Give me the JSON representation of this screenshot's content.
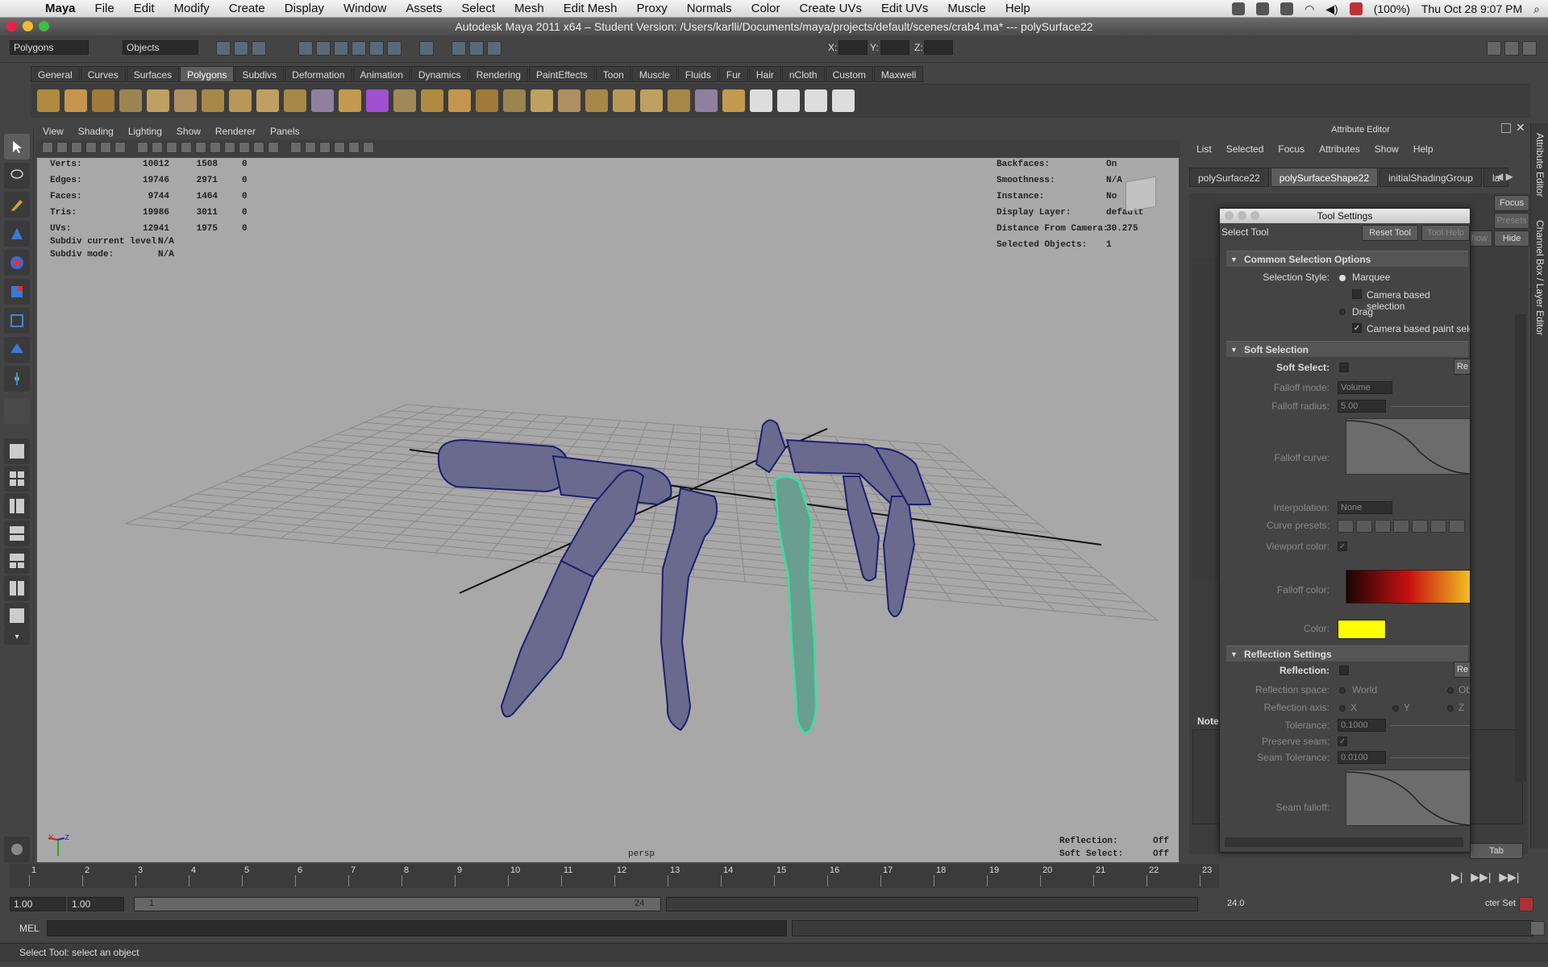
{
  "macmenu": {
    "app": "Maya",
    "items": [
      "File",
      "Edit",
      "Modify",
      "Create",
      "Display",
      "Window",
      "Assets",
      "Select",
      "Mesh",
      "Edit Mesh",
      "Proxy",
      "Normals",
      "Color",
      "Create UVs",
      "Edit UVs",
      "Muscle",
      "Help"
    ],
    "battery": "(100%)",
    "clock": "Thu Oct 28  9:07 PM"
  },
  "window": {
    "title": "Autodesk Maya 2011 x64 – Student Version: /Users/karlli/Documents/maya/projects/default/scenes/crab4.ma*   ---   polySurface22"
  },
  "statusline": {
    "menuset": "Polygons",
    "selection_mode": "Objects",
    "x_label": "X:",
    "y_label": "Y:",
    "z_label": "Z:"
  },
  "shelf_tabs": [
    "General",
    "Curves",
    "Surfaces",
    "Polygons",
    "Subdivs",
    "Deformation",
    "Animation",
    "Dynamics",
    "Rendering",
    "PaintEffects",
    "Toon",
    "Muscle",
    "Fluids",
    "Fur",
    "Hair",
    "nCloth",
    "Custom",
    "Maxwell"
  ],
  "shelf_active": "Polygons",
  "viewport": {
    "menus": [
      "View",
      "Shading",
      "Lighting",
      "Show",
      "Renderer",
      "Panels"
    ],
    "hud_left": [
      {
        "label": "Verts:",
        "a": "10012",
        "b": "1508",
        "c": "0"
      },
      {
        "label": "Edges:",
        "a": "19746",
        "b": "2971",
        "c": "0"
      },
      {
        "label": "Faces:",
        "a": "9744",
        "b": "1464",
        "c": "0"
      },
      {
        "label": "Tris:",
        "a": "19986",
        "b": "3011",
        "c": "0"
      },
      {
        "label": "UVs:",
        "a": "12941",
        "b": "1975",
        "c": "0"
      }
    ],
    "subdiv_level_label": "Subdiv current level:",
    "subdiv_level_value": "N/A",
    "subdiv_mode_label": "Subdiv mode:",
    "subdiv_mode_value": "N/A",
    "hud_right": [
      {
        "label": "Backfaces:",
        "value": "On"
      },
      {
        "label": "Smoothness:",
        "value": "N/A"
      },
      {
        "label": "Instance:",
        "value": "No"
      },
      {
        "label": "Display Layer:",
        "value": "default"
      },
      {
        "label": "Distance From Camera:",
        "value": "30.275"
      },
      {
        "label": "Selected Objects:",
        "value": "1"
      }
    ],
    "camera": "persp",
    "reflection_label": "Reflection:",
    "reflection_value": "Off",
    "softselect_label": "Soft Select:",
    "softselect_value": "Off",
    "axis_x": "x",
    "axis_z": "z"
  },
  "timeline": {
    "ticks": [
      "1",
      "2",
      "3",
      "4",
      "5",
      "6",
      "7",
      "8",
      "9",
      "10",
      "11",
      "12",
      "13",
      "14",
      "15",
      "16",
      "17",
      "18",
      "19",
      "20",
      "21",
      "22",
      "23"
    ],
    "start": "1.00",
    "start2": "1.00",
    "range_start": "1",
    "range_end": "24",
    "end": "24.0",
    "char_set": "cter Set"
  },
  "mel_label": "MEL",
  "help_line": "Select Tool: select an object",
  "attribute_editor": {
    "title": "Attribute Editor",
    "menus": [
      "List",
      "Selected",
      "Focus",
      "Attributes",
      "Show",
      "Help"
    ],
    "tabs": [
      "polySurface22",
      "polySurfaceShape22",
      "initialShadingGroup",
      "la"
    ],
    "active_tab": "polySurfaceShape22",
    "focus_button": "Focus",
    "presets_button": "Presets",
    "show_button": "how",
    "hide_button": "Hide",
    "notes_label": "Notes",
    "tab_button": "Tab",
    "side_attr": "Attribute Editor",
    "side_channel": "Channel Box / Layer Editor"
  },
  "tool_settings": {
    "title": "Tool Settings",
    "tool_name": "Select Tool",
    "reset_button": "Reset Tool",
    "help_button": "Tool Help",
    "sec_common": "Common Selection Options",
    "selection_style_label": "Selection Style:",
    "marquee": "Marquee",
    "camera_based_selection": "Camera based selection",
    "drag": "Drag",
    "camera_based_paint": "Camera based paint sele",
    "sec_soft": "Soft Selection",
    "soft_select_label": "Soft Select:",
    "reset_short": "Re",
    "falloff_mode_label": "Falloff mode:",
    "falloff_mode_value": "Volume",
    "falloff_radius_label": "Falloff radius:",
    "falloff_radius_value": "5.00",
    "falloff_curve_label": "Falloff curve:",
    "interpolation_label": "Interpolation:",
    "interpolation_value": "None",
    "curve_presets_label": "Curve presets:",
    "viewport_color_label": "Viewport color:",
    "falloff_color_label": "Falloff color:",
    "color_label": "Color:",
    "color_swatch": "#ffff00",
    "sec_reflection": "Reflection Settings",
    "reflection_label": "Reflection:",
    "reflection_space_label": "Reflection space:",
    "reflection_space_world": "World",
    "reflection_space_obj": "Ob",
    "reflection_axis_label": "Reflection axis:",
    "axis_x": "X",
    "axis_y": "Y",
    "axis_z": "Z",
    "tolerance_label": "Tolerance:",
    "tolerance_value": "0.1000",
    "preserve_seam_label": "Preserve seam:",
    "seam_tolerance_label": "Seam Tolerance:",
    "seam_tolerance_value": "0.0100",
    "seam_falloff_label": "Seam falloff:"
  },
  "colors": {
    "mesh": "#1c1f6e",
    "selected_mesh": "#35e0a0",
    "viewport_bg": "#a8a8a8"
  }
}
